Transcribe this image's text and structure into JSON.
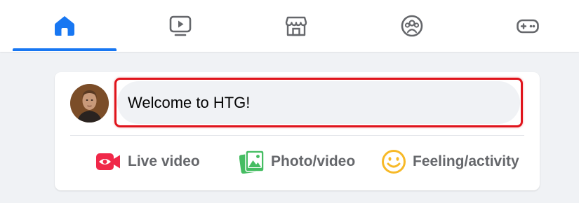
{
  "nav": {
    "tabs": [
      {
        "name": "home",
        "icon": "home-icon",
        "active": true
      },
      {
        "name": "watch",
        "icon": "video-play-icon",
        "active": false
      },
      {
        "name": "marketplace",
        "icon": "store-icon",
        "active": false
      },
      {
        "name": "groups",
        "icon": "groups-icon",
        "active": false
      },
      {
        "name": "gaming",
        "icon": "gamepad-icon",
        "active": false
      }
    ]
  },
  "composer": {
    "input_text": "Welcome to HTG!",
    "avatar_icon": "user-avatar"
  },
  "actions": [
    {
      "label": "Live video",
      "icon": "live-video-icon",
      "color": "#F02849"
    },
    {
      "label": "Photo/video",
      "icon": "photo-video-icon",
      "color": "#45BD62"
    },
    {
      "label": "Feeling/activity",
      "icon": "feeling-icon",
      "color": "#F7B928"
    }
  ],
  "colors": {
    "accent": "#1877F2",
    "icon_gray": "#65676B",
    "highlight": "#E0141C",
    "background": "#F0F2F5"
  }
}
